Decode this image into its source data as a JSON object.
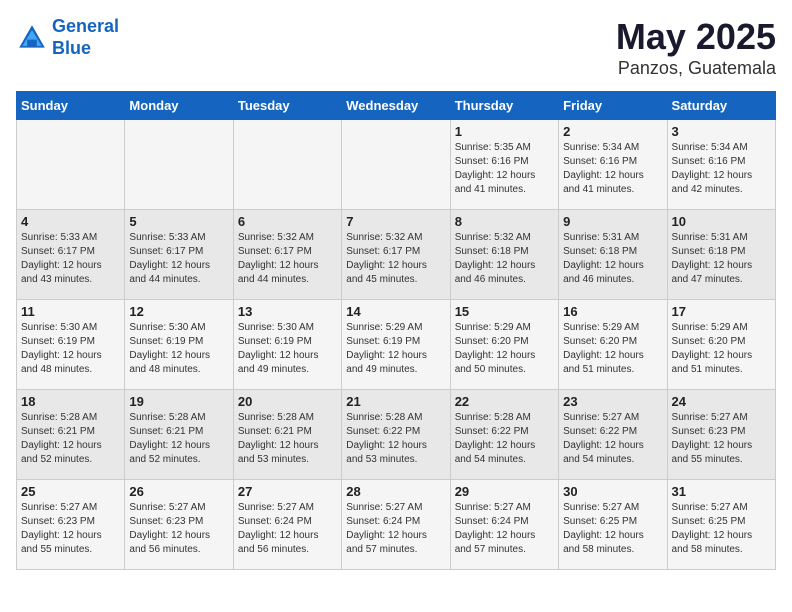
{
  "logo": {
    "line1": "General",
    "line2": "Blue"
  },
  "title": "May 2025",
  "subtitle": "Panzos, Guatemala",
  "days_of_week": [
    "Sunday",
    "Monday",
    "Tuesday",
    "Wednesday",
    "Thursday",
    "Friday",
    "Saturday"
  ],
  "weeks": [
    [
      {
        "day": "",
        "info": ""
      },
      {
        "day": "",
        "info": ""
      },
      {
        "day": "",
        "info": ""
      },
      {
        "day": "",
        "info": ""
      },
      {
        "day": "1",
        "info": "Sunrise: 5:35 AM\nSunset: 6:16 PM\nDaylight: 12 hours\nand 41 minutes."
      },
      {
        "day": "2",
        "info": "Sunrise: 5:34 AM\nSunset: 6:16 PM\nDaylight: 12 hours\nand 41 minutes."
      },
      {
        "day": "3",
        "info": "Sunrise: 5:34 AM\nSunset: 6:16 PM\nDaylight: 12 hours\nand 42 minutes."
      }
    ],
    [
      {
        "day": "4",
        "info": "Sunrise: 5:33 AM\nSunset: 6:17 PM\nDaylight: 12 hours\nand 43 minutes."
      },
      {
        "day": "5",
        "info": "Sunrise: 5:33 AM\nSunset: 6:17 PM\nDaylight: 12 hours\nand 44 minutes."
      },
      {
        "day": "6",
        "info": "Sunrise: 5:32 AM\nSunset: 6:17 PM\nDaylight: 12 hours\nand 44 minutes."
      },
      {
        "day": "7",
        "info": "Sunrise: 5:32 AM\nSunset: 6:17 PM\nDaylight: 12 hours\nand 45 minutes."
      },
      {
        "day": "8",
        "info": "Sunrise: 5:32 AM\nSunset: 6:18 PM\nDaylight: 12 hours\nand 46 minutes."
      },
      {
        "day": "9",
        "info": "Sunrise: 5:31 AM\nSunset: 6:18 PM\nDaylight: 12 hours\nand 46 minutes."
      },
      {
        "day": "10",
        "info": "Sunrise: 5:31 AM\nSunset: 6:18 PM\nDaylight: 12 hours\nand 47 minutes."
      }
    ],
    [
      {
        "day": "11",
        "info": "Sunrise: 5:30 AM\nSunset: 6:19 PM\nDaylight: 12 hours\nand 48 minutes."
      },
      {
        "day": "12",
        "info": "Sunrise: 5:30 AM\nSunset: 6:19 PM\nDaylight: 12 hours\nand 48 minutes."
      },
      {
        "day": "13",
        "info": "Sunrise: 5:30 AM\nSunset: 6:19 PM\nDaylight: 12 hours\nand 49 minutes."
      },
      {
        "day": "14",
        "info": "Sunrise: 5:29 AM\nSunset: 6:19 PM\nDaylight: 12 hours\nand 49 minutes."
      },
      {
        "day": "15",
        "info": "Sunrise: 5:29 AM\nSunset: 6:20 PM\nDaylight: 12 hours\nand 50 minutes."
      },
      {
        "day": "16",
        "info": "Sunrise: 5:29 AM\nSunset: 6:20 PM\nDaylight: 12 hours\nand 51 minutes."
      },
      {
        "day": "17",
        "info": "Sunrise: 5:29 AM\nSunset: 6:20 PM\nDaylight: 12 hours\nand 51 minutes."
      }
    ],
    [
      {
        "day": "18",
        "info": "Sunrise: 5:28 AM\nSunset: 6:21 PM\nDaylight: 12 hours\nand 52 minutes."
      },
      {
        "day": "19",
        "info": "Sunrise: 5:28 AM\nSunset: 6:21 PM\nDaylight: 12 hours\nand 52 minutes."
      },
      {
        "day": "20",
        "info": "Sunrise: 5:28 AM\nSunset: 6:21 PM\nDaylight: 12 hours\nand 53 minutes."
      },
      {
        "day": "21",
        "info": "Sunrise: 5:28 AM\nSunset: 6:22 PM\nDaylight: 12 hours\nand 53 minutes."
      },
      {
        "day": "22",
        "info": "Sunrise: 5:28 AM\nSunset: 6:22 PM\nDaylight: 12 hours\nand 54 minutes."
      },
      {
        "day": "23",
        "info": "Sunrise: 5:27 AM\nSunset: 6:22 PM\nDaylight: 12 hours\nand 54 minutes."
      },
      {
        "day": "24",
        "info": "Sunrise: 5:27 AM\nSunset: 6:23 PM\nDaylight: 12 hours\nand 55 minutes."
      }
    ],
    [
      {
        "day": "25",
        "info": "Sunrise: 5:27 AM\nSunset: 6:23 PM\nDaylight: 12 hours\nand 55 minutes."
      },
      {
        "day": "26",
        "info": "Sunrise: 5:27 AM\nSunset: 6:23 PM\nDaylight: 12 hours\nand 56 minutes."
      },
      {
        "day": "27",
        "info": "Sunrise: 5:27 AM\nSunset: 6:24 PM\nDaylight: 12 hours\nand 56 minutes."
      },
      {
        "day": "28",
        "info": "Sunrise: 5:27 AM\nSunset: 6:24 PM\nDaylight: 12 hours\nand 57 minutes."
      },
      {
        "day": "29",
        "info": "Sunrise: 5:27 AM\nSunset: 6:24 PM\nDaylight: 12 hours\nand 57 minutes."
      },
      {
        "day": "30",
        "info": "Sunrise: 5:27 AM\nSunset: 6:25 PM\nDaylight: 12 hours\nand 58 minutes."
      },
      {
        "day": "31",
        "info": "Sunrise: 5:27 AM\nSunset: 6:25 PM\nDaylight: 12 hours\nand 58 minutes."
      }
    ]
  ]
}
